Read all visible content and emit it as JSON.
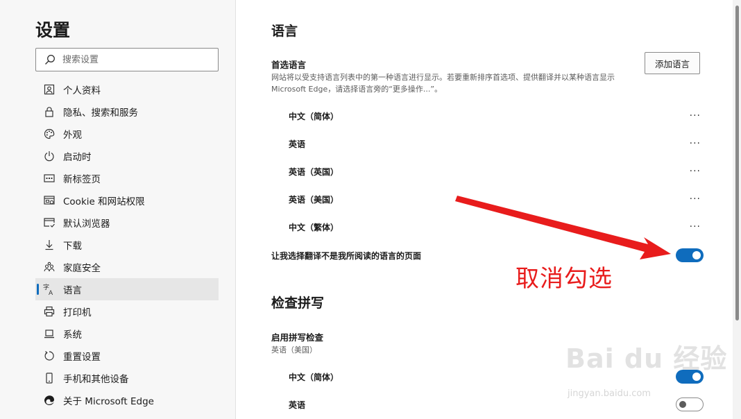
{
  "sidebar": {
    "title": "设置",
    "search": {
      "placeholder": "搜索设置",
      "value": ""
    },
    "items": [
      {
        "label": "个人资料",
        "icon": "profile-icon"
      },
      {
        "label": "隐私、搜索和服务",
        "icon": "lock-icon"
      },
      {
        "label": "外观",
        "icon": "palette-icon"
      },
      {
        "label": "启动时",
        "icon": "power-icon"
      },
      {
        "label": "新标签页",
        "icon": "new-tab-icon"
      },
      {
        "label": "Cookie 和网站权限",
        "icon": "site-permissions-icon"
      },
      {
        "label": "默认浏览器",
        "icon": "default-browser-icon"
      },
      {
        "label": "下载",
        "icon": "download-icon"
      },
      {
        "label": "家庭安全",
        "icon": "family-icon"
      },
      {
        "label": "语言",
        "icon": "language-icon",
        "active": true
      },
      {
        "label": "打印机",
        "icon": "printer-icon"
      },
      {
        "label": "系统",
        "icon": "laptop-icon"
      },
      {
        "label": "重置设置",
        "icon": "reset-icon"
      },
      {
        "label": "手机和其他设备",
        "icon": "phone-icon"
      },
      {
        "label": "关于 Microsoft Edge",
        "icon": "edge-logo-icon"
      }
    ]
  },
  "main": {
    "language_section": {
      "title": "语言",
      "preferred_title": "首选语言",
      "preferred_desc": "网站将以受支持语言列表中的第一种语言进行显示。若要重新排序首选项、提供翻译并以某种语言显示 Microsoft Edge，请选择语言旁的“更多操作...”。",
      "add_button": "添加语言",
      "languages": [
        "中文（简体）",
        "英语",
        "英语（英国）",
        "英语（美国）",
        "中文（繁体）"
      ],
      "more_label": "···",
      "translate_toggle_label": "让我选择翻译不是我所阅读的语言的页面",
      "translate_toggle_on": true
    },
    "spellcheck_section": {
      "title": "检查拼写",
      "enable_title": "启用拼写检查",
      "enable_sub": "英语（美国）",
      "languages": [
        "中文（简体）",
        "英语"
      ]
    }
  },
  "annotation": {
    "text": "取消勾选",
    "color": "#e81c1c"
  },
  "watermark": {
    "main": "Bai du 经验",
    "sub": "jingyan.baidu.com"
  },
  "colors": {
    "accent": "#0f6cbd",
    "annotation": "#e81c1c"
  }
}
